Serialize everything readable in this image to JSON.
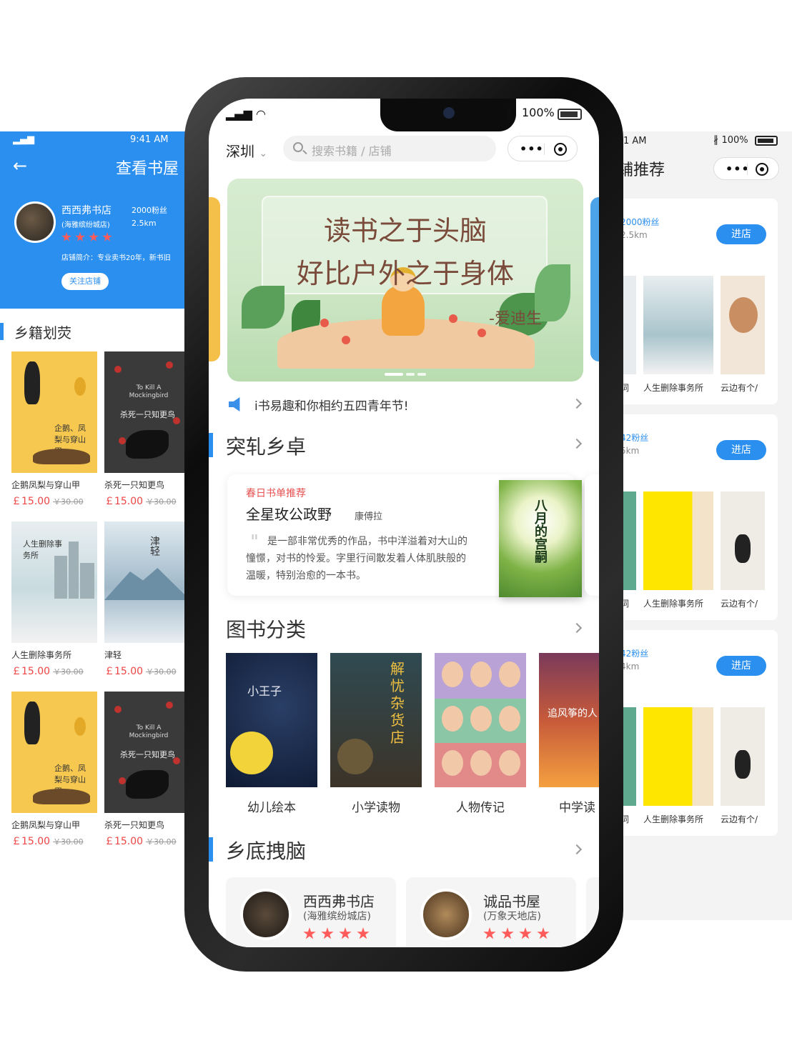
{
  "left_screen": {
    "status_time": "9:41 AM",
    "title": "查看书屋",
    "shop": {
      "name": "西西弗书店",
      "branch": "(海雅缤纷城店)",
      "fans": "2000粉丝",
      "distance": "2.5km",
      "rating": 4,
      "intro": "店铺简介：专业卖书20年，新书旧",
      "follow_label": "关注店铺"
    },
    "section_title": "乡籍划荧",
    "books": [
      {
        "name": "企鹅凤梨与穿山甲",
        "price": "￡15.00",
        "old_price": "￥30.00",
        "cover_text": "企鹅、凤梨与穿山甲"
      },
      {
        "name": "杀死一只知更鸟",
        "price": "￡15.00",
        "old_price": "￥30.00",
        "cover_text": "杀死一只知更鸟",
        "cover_en": "To Kill A Mockingbird"
      },
      {
        "name": "人生删除事务所",
        "price": "￡15.00",
        "old_price": "￥30.00",
        "cover_text": "人生删除事务所"
      },
      {
        "name": "津轻",
        "price": "￡15.00",
        "old_price": "￥30.00",
        "cover_text": "津轻"
      },
      {
        "name": "企鹅凤梨与穿山甲",
        "price": "￡15.00",
        "old_price": "￥30.00",
        "cover_text": "企鹅、凤梨与穿山甲"
      },
      {
        "name": "杀死一只知更鸟",
        "price": "￡15.00",
        "old_price": "￥30.00",
        "cover_text": "杀死一只知更鸟",
        "cover_en": "To Kill A Mockingbird"
      }
    ]
  },
  "right_screen": {
    "status_time": "1 AM",
    "battery": "100%",
    "title": "铺推荐",
    "shops": [
      {
        "fans": "2000粉丝",
        "distance": "2.5km",
        "enter_label": "进店",
        "books": [
          "词",
          "人生删除事务所",
          "云边有个/"
        ]
      },
      {
        "fans": "42粉丝",
        "distance": "5km",
        "enter_label": "进店",
        "books": [
          "词",
          "人生删除事务所",
          "云边有个/"
        ]
      },
      {
        "fans": "42粉丝",
        "distance": "4km",
        "enter_label": "进店",
        "books": [
          "词",
          "人生删除事务所",
          "云边有个/"
        ]
      }
    ]
  },
  "phone": {
    "status_battery": "100%",
    "city": "深圳",
    "search_placeholder": "搜索书籍 / 店铺",
    "banner": {
      "line1": "读书之于头脑",
      "line2": "好比户外之于身体",
      "author": "-爱迪生"
    },
    "notice": "i书易趣和你相约五四青年节!",
    "section1_title": "突轧乡卓",
    "recommend": {
      "tag": "春日书单推荐",
      "title": "全星玫公政野",
      "author": "康傅拉",
      "description": "是一部非常优秀的作品，书中洋溢着对大山的憧憬，对书的怜爱。字里行间散发着人体肌肤般的温暖，特别治愈的一本书。",
      "cover_title": "八月的宫嗣"
    },
    "section2_title": "图书分类",
    "categories": [
      {
        "label": "幼儿绘本",
        "cover_text": "小王子"
      },
      {
        "label": "小学读物",
        "cover_text": "解忧杂货店"
      },
      {
        "label": "人物传记",
        "cover_text": ""
      },
      {
        "label": "中学读",
        "cover_text": "追风筝的人"
      }
    ],
    "section3_title": "乡底拽脑",
    "shops": [
      {
        "name": "西西弗书店",
        "branch": "(海雅缤纷城店)",
        "rating": 4
      },
      {
        "name": "诚品书屋",
        "branch": "(万象天地店)",
        "rating": 4
      }
    ]
  },
  "colors": {
    "accent": "#2b8ff0",
    "price": "#ee4444",
    "star": "#ff5b5b",
    "tag": "#e85050"
  }
}
